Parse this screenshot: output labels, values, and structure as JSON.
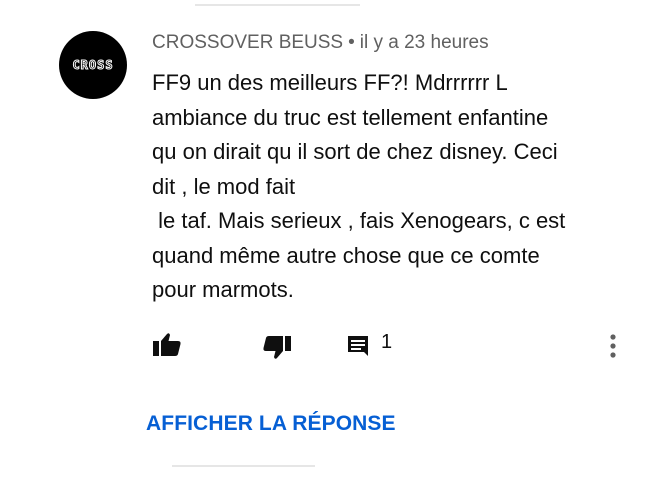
{
  "comment": {
    "avatar_text": "CROSS",
    "author": "CROSSOVER BEUSS",
    "separator": "•",
    "timestamp": "il y a 23 heures",
    "body_lines": [
      "FF9 un des meilleurs FF?! Mdrrrrrr L",
      "ambiance du truc est tellement enfantine",
      "qu on dirait qu il sort de chez disney. Ceci",
      "dit , le mod fait",
      " le taf. Mais serieux , fais Xenogears, c est",
      "quand même autre chose que ce comte",
      "pour marmots."
    ],
    "actions": {
      "like_icon": "thumbs-up-icon",
      "dislike_icon": "thumbs-down-icon",
      "reply_icon": "comment-icon",
      "reply_count": "1",
      "more_icon": "more-vertical-icon"
    },
    "show_reply_label": "AFFICHER LA RÉPONSE"
  },
  "colors": {
    "meta_text": "#606060",
    "body_text": "#0f0f0f",
    "link": "#065fd4",
    "icon": "#0f0f0f"
  }
}
